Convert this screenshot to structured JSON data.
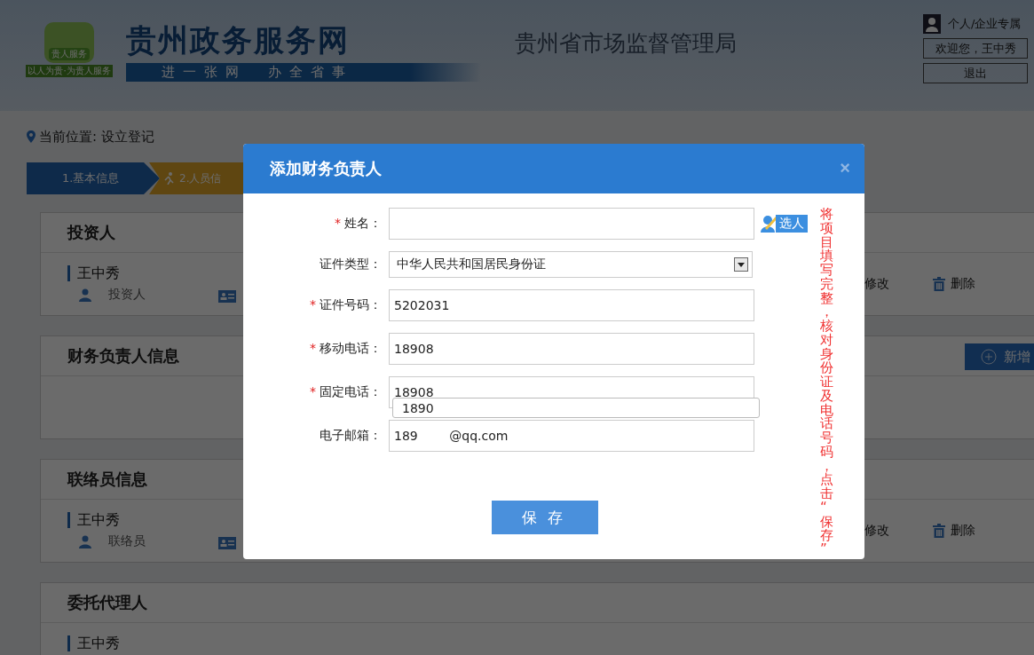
{
  "header": {
    "logo_badge": "贵人服务",
    "logo_tagline": "以人为贵·为贵人服务",
    "site_title": "贵州政务服务网",
    "site_slogan": "进一张网　办全省事",
    "department": "贵州省市场监督管理局",
    "user_zone": "个人/企业专属",
    "welcome": "欢迎您，王中秀",
    "logout": "退出"
  },
  "breadcrumb": "当前位置: 设立登记",
  "steps": [
    {
      "label": "1.基本信息",
      "selected": true
    },
    {
      "label": "2.人员信",
      "selected": false
    }
  ],
  "sections": [
    {
      "title": "投资人",
      "people": [
        {
          "name": "王中秀",
          "role": "投资人",
          "edit": "修改",
          "delete": "删除"
        }
      ]
    },
    {
      "title": "财务负责人信息",
      "add_button": "新增"
    },
    {
      "title": "联络员信息",
      "people": [
        {
          "name": "王中秀",
          "role": "联络员",
          "edit": "修改",
          "delete": "删除"
        }
      ]
    },
    {
      "title": "委托代理人",
      "people": [
        {
          "name": "王中秀"
        }
      ]
    }
  ],
  "dialog": {
    "title": "添加财务负责人",
    "close": "×",
    "required_mark": "*",
    "fields": [
      {
        "label": "姓名：",
        "required": true,
        "kind": "text",
        "pick_button": "选人"
      },
      {
        "label": "证件类型：",
        "required": false,
        "kind": "select",
        "value": "中华人民共和国居民身份证"
      },
      {
        "label": "证件号码：",
        "required": true,
        "kind": "text",
        "value": "5202031"
      },
      {
        "label": "移动电话：",
        "required": true,
        "kind": "text",
        "value": "18908"
      },
      {
        "label": "固定电话：",
        "required": true,
        "kind": "text",
        "value": "18908",
        "suggestion": "1890"
      },
      {
        "label": "电子邮箱：",
        "required": false,
        "kind": "text",
        "value": "189        @qq.com"
      }
    ],
    "save_button": "保存",
    "hint": "将项目填写完整，核对身份证及电话号码，点击“保存”"
  }
}
